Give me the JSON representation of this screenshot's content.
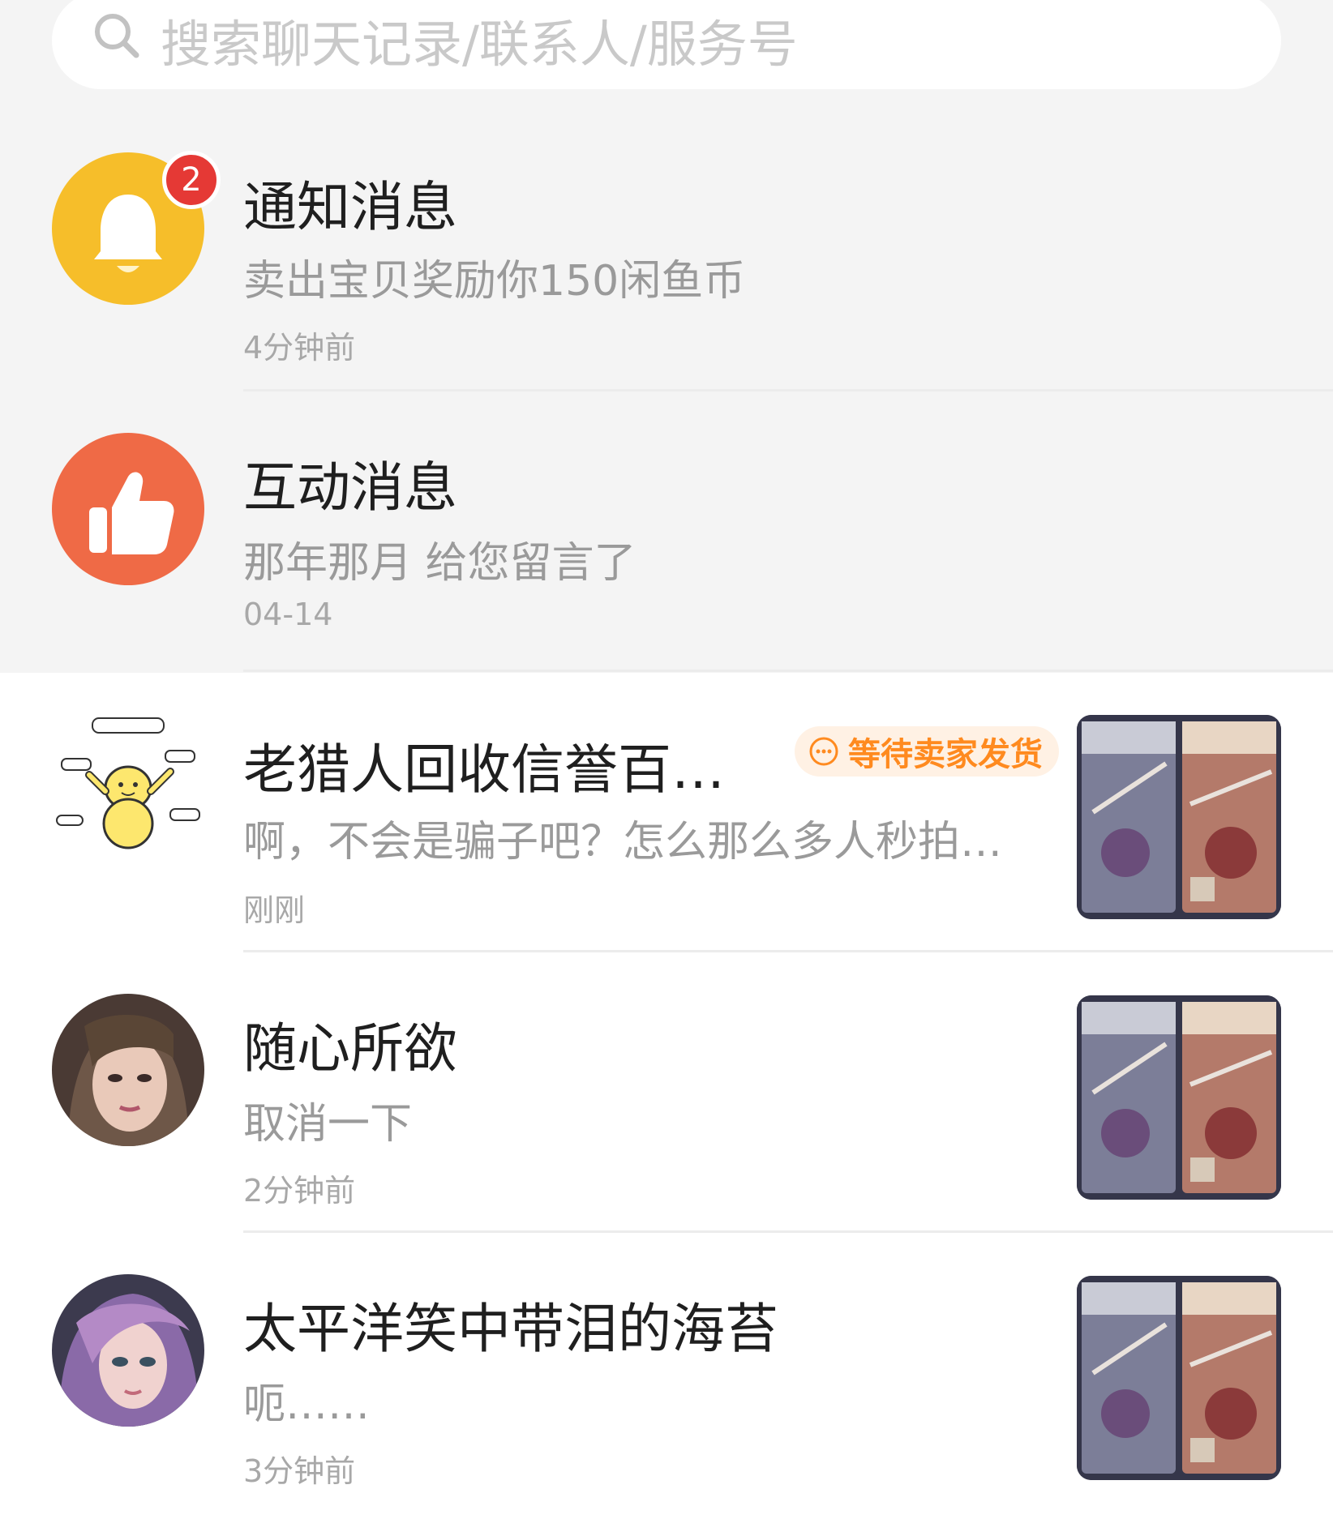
{
  "search": {
    "placeholder": "搜索聊天记录/联系人/服务号"
  },
  "system_items": [
    {
      "title": "通知消息",
      "subtitle": "卖出宝贝奖励你150闲鱼币",
      "time": "4分钟前",
      "badge": "2",
      "icon": "bell-icon",
      "color": "#f6be2a"
    },
    {
      "title": "互动消息",
      "subtitle": "那年那月 给您留言了",
      "time": "04-14",
      "icon": "thumbs-up-icon",
      "color": "#ef6a46"
    }
  ],
  "conversations": [
    {
      "name": "老猎人回收信誉百…",
      "preview": "啊，不会是骗子吧？怎么那么多人秒拍…",
      "time": "刚刚",
      "status": "等待卖家发货",
      "status_color": "#ff8a1f"
    },
    {
      "name": "随心所欲",
      "preview": "取消一下",
      "time": "2分钟前"
    },
    {
      "name": "太平洋笑中带泪的海苔",
      "preview": "呃……",
      "time": "3分钟前"
    }
  ]
}
